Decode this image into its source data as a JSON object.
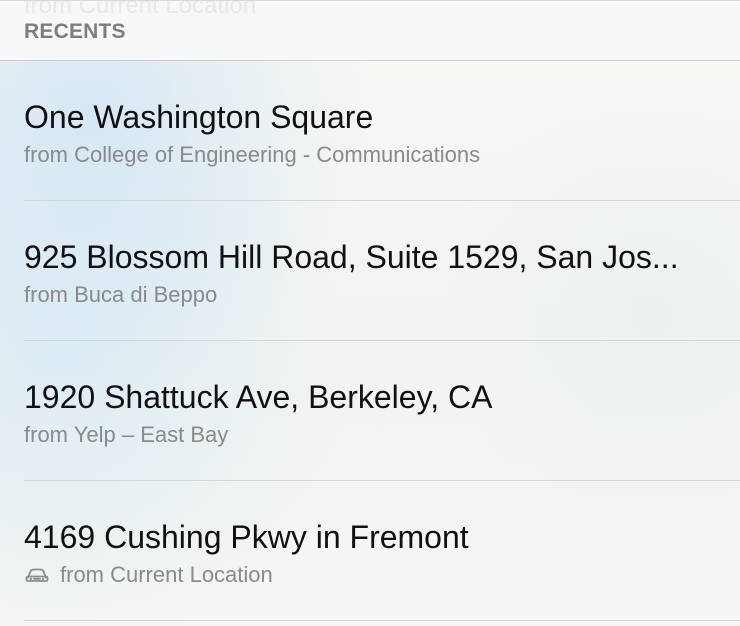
{
  "header": {
    "section_title": "RECENTS",
    "ghost_text": "from Current Location"
  },
  "recents": [
    {
      "title": "One Washington Square",
      "subtitle": "from College of Engineering - Communications"
    },
    {
      "title": "925 Blossom Hill Road, Suite 1529, San Jos...",
      "subtitle": "from Buca di Beppo"
    },
    {
      "title": "1920 Shattuck Ave, Berkeley, CA",
      "subtitle": "from Yelp – East Bay"
    },
    {
      "title": "4169 Cushing Pkwy in Fremont",
      "subtitle": "from Current Location",
      "icon": "car-icon"
    }
  ]
}
